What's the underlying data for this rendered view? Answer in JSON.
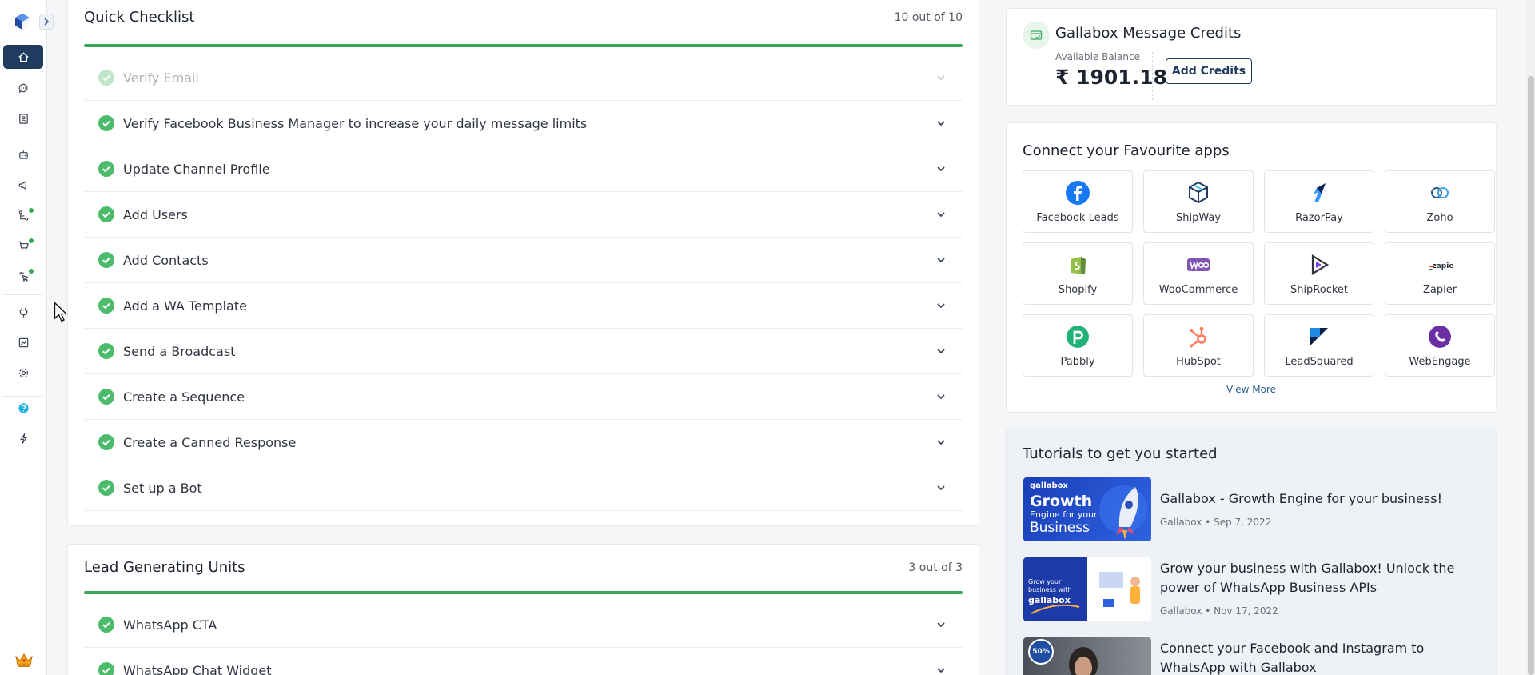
{
  "colors": {
    "accent": "#1f3b60",
    "success": "#3aa757",
    "link": "#2a5c8f"
  },
  "sidebar": {
    "items": [
      {
        "name": "home-icon",
        "active": true
      },
      {
        "name": "chat-icon"
      },
      {
        "name": "contacts-book-icon"
      },
      {
        "name": "bot-icon"
      },
      {
        "name": "megaphone-icon"
      },
      {
        "name": "flow-icon",
        "dot": true
      },
      {
        "name": "cart-icon",
        "dot": true
      },
      {
        "name": "click-icon",
        "dot": true
      },
      {
        "name": "plug-icon"
      },
      {
        "name": "analytics-icon"
      },
      {
        "name": "gear-icon"
      },
      {
        "name": "help-icon"
      },
      {
        "name": "lightning-icon"
      }
    ]
  },
  "checklist": {
    "title": "Quick Checklist",
    "count": "10 out of 10",
    "progress": 1.0,
    "items": [
      {
        "label": "Verify Email",
        "muted": true
      },
      {
        "label": "Verify Facebook Business Manager to increase your daily message limits"
      },
      {
        "label": "Update Channel Profile"
      },
      {
        "label": "Add Users"
      },
      {
        "label": "Add Contacts"
      },
      {
        "label": "Add a WA Template"
      },
      {
        "label": "Send a Broadcast"
      },
      {
        "label": "Create a Sequence"
      },
      {
        "label": "Create a Canned Response"
      },
      {
        "label": "Set up a Bot"
      }
    ]
  },
  "lead_units": {
    "title": "Lead Generating Units",
    "count": "3 out of 3",
    "progress": 1.0,
    "items": [
      {
        "label": "WhatsApp CTA"
      },
      {
        "label": "WhatsApp Chat Widget"
      }
    ]
  },
  "credits": {
    "title": "Gallabox Message Credits",
    "balance_label": "Available Balance",
    "balance": "₹ 1901.18",
    "add_label": "Add Credits"
  },
  "apps": {
    "title": "Connect your Favourite apps",
    "items": [
      {
        "name": "Facebook Leads",
        "icon": "facebook-icon"
      },
      {
        "name": "ShipWay",
        "icon": "shipway-icon"
      },
      {
        "name": "RazorPay",
        "icon": "razorpay-icon"
      },
      {
        "name": "Zoho",
        "icon": "zoho-icon"
      },
      {
        "name": "Shopify",
        "icon": "shopify-icon"
      },
      {
        "name": "WooCommerce",
        "icon": "woocommerce-icon"
      },
      {
        "name": "ShipRocket",
        "icon": "shiprocket-icon"
      },
      {
        "name": "Zapier",
        "icon": "zapier-icon"
      },
      {
        "name": "Pabbly",
        "icon": "pabbly-icon"
      },
      {
        "name": "HubSpot",
        "icon": "hubspot-icon"
      },
      {
        "name": "LeadSquared",
        "icon": "leadsquared-icon"
      },
      {
        "name": "WebEngage",
        "icon": "webengage-icon"
      }
    ],
    "view_more": "View More"
  },
  "tutorials": {
    "title": "Tutorials to get you started",
    "items": [
      {
        "title": "Gallabox - Growth Engine for your business!",
        "author": "Gallabox",
        "date": "• Sep 7, 2022",
        "thumb_brand": "gallabox",
        "thumb_line1": "Growth",
        "thumb_line2": "Engine for your",
        "thumb_line3": "Business"
      },
      {
        "title": "Grow your business with Gallabox! Unlock the power of WhatsApp Business APIs",
        "author": "Gallabox",
        "date": "• Nov 17, 2022",
        "thumb_line1": "Grow your",
        "thumb_line2": "business with",
        "thumb_brand": "gallabox"
      },
      {
        "title": "Connect your Facebook and Instagram to WhatsApp with Gallabox",
        "thumb_badge": "50%"
      }
    ]
  }
}
